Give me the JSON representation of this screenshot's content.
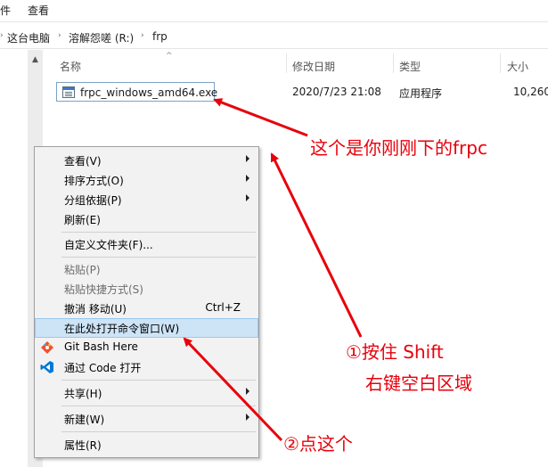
{
  "ribbon": {
    "tabs": [
      "件",
      "查看"
    ]
  },
  "address": {
    "crumbs": [
      "这台电脑",
      "溶解怨嗟 (R:)",
      "frp"
    ]
  },
  "columns": {
    "name": "名称",
    "modified": "修改日期",
    "type": "类型",
    "size": "大小"
  },
  "file": {
    "name": "frpc_windows_amd64.exe",
    "modified": "2020/7/23 21:08",
    "type": "应用程序",
    "size": "10,260"
  },
  "menu": {
    "items": [
      {
        "label": "查看(V)",
        "submenu": true
      },
      {
        "label": "排序方式(O)",
        "submenu": true
      },
      {
        "label": "分组依据(P)",
        "submenu": true
      },
      {
        "label": "刷新(E)"
      },
      {
        "label": "自定义文件夹(F)..."
      },
      {
        "label": "粘贴(P)",
        "disabled": true
      },
      {
        "label": "粘贴快捷方式(S)",
        "disabled": true
      },
      {
        "label": "撤消 移动(U)",
        "shortcut": "Ctrl+Z"
      },
      {
        "label": "在此处打开命令窗口(W)",
        "highlighted": true
      },
      {
        "label": "Git Bash Here",
        "icon": "git-icon"
      },
      {
        "label": "通过 Code 打开",
        "icon": "vscode-icon"
      },
      {
        "label": "共享(H)",
        "submenu": true
      },
      {
        "label": "新建(W)",
        "submenu": true
      },
      {
        "label": "属性(R)"
      }
    ]
  },
  "annotations": {
    "frpc_note": "这个是你刚刚下的frpc",
    "step1_line1": "①按住 Shift",
    "step1_line2": "右键空白区域",
    "step2": "②点这个"
  },
  "colors": {
    "annotation": "#e8000b",
    "highlight": "#cde4f7"
  }
}
